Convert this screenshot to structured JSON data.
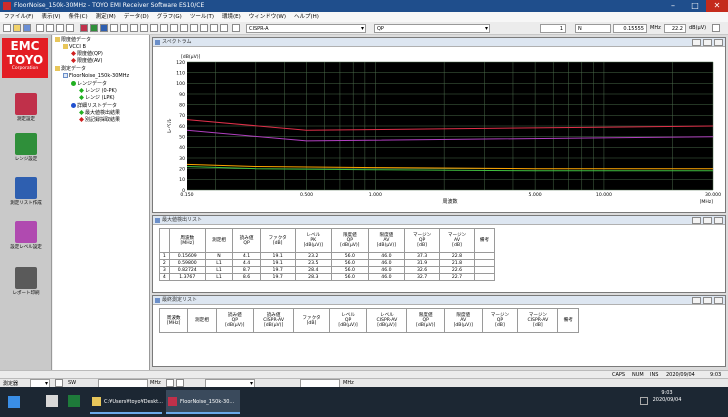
{
  "window": {
    "title": "FloorNoise_150k-30MHz - TOYO EMI Receiver Software ES10/CE"
  },
  "menu": [
    "ファイル(F)",
    "表示(V)",
    "条件(C)",
    "測定(M)",
    "データ(D)",
    "グラフ(G)",
    "ツール(T)",
    "環境(E)",
    "ウィンドウ(W)",
    "ヘルプ(H)"
  ],
  "toolbar": {
    "detector": "CISPR-A",
    "mode": "QP",
    "field1": "1",
    "field2": "N",
    "freq": "0.15555",
    "freq_unit": "MHz",
    "level": "22.2",
    "level_unit": "dB(μV)"
  },
  "sidebar": {
    "logo_main": "EMC",
    "logo_sub": "TOYO",
    "logo_corp": "Corporation",
    "buttons": [
      {
        "label": "測定設定",
        "color": "#c0304a"
      },
      {
        "label": "レンジ設定",
        "color": "#2f8f3a"
      },
      {
        "label": "測定リスト作成",
        "color": "#2e5fb0"
      },
      {
        "label": "設定レベル設定",
        "color": "#b04ab0"
      },
      {
        "label": "レポート印刷",
        "color": "#5a5a5a"
      }
    ]
  },
  "tree": [
    {
      "label": "限度値データ",
      "indent": 0,
      "icon": "folder"
    },
    {
      "label": "VCCI B",
      "indent": 1,
      "icon": "folder"
    },
    {
      "label": "限度値(QP)",
      "indent": 2,
      "icon": "diamond-red"
    },
    {
      "label": "限度値(AV)",
      "indent": 2,
      "icon": "diamond-red"
    },
    {
      "label": "測定データ",
      "indent": 0,
      "icon": "folder"
    },
    {
      "label": "FloorNoise_150k-30MHz",
      "indent": 1,
      "icon": "doc"
    },
    {
      "label": "レンジデータ",
      "indent": 2,
      "icon": "circle-green"
    },
    {
      "label": "レンジ (0-PK)",
      "indent": 3,
      "icon": "diamond-green"
    },
    {
      "label": "レンジ (LPK)",
      "indent": 3,
      "icon": "diamond-green"
    },
    {
      "label": "詳細リストデータ",
      "indent": 2,
      "icon": "circle-blue"
    },
    {
      "label": "最大値検出結果",
      "indent": 3,
      "icon": "diamond-green"
    },
    {
      "label": "別記録採取結果",
      "indent": 3,
      "icon": "diamond-red"
    }
  ],
  "spectrum": {
    "title": "スペクトラム"
  },
  "chart_data": {
    "type": "line",
    "ylabel": "レベル",
    "yunit": "[dB(μV)]",
    "xlabel": "周波数",
    "xunit": "[MHz]",
    "xscale": "log",
    "xlim": [
      0.15,
      30
    ],
    "ylim": [
      0,
      120
    ],
    "xticks": [
      "0.150",
      "0.500",
      "1.000",
      "5.000",
      "10.000",
      "30.000"
    ],
    "yticks": [
      "0",
      "10",
      "20",
      "30",
      "40",
      "50",
      "60",
      "70",
      "80",
      "90",
      "100",
      "110",
      "120"
    ],
    "grid": true,
    "series": [
      {
        "color": "#e0304a",
        "x": [
          0.15,
          0.5,
          0.5,
          30
        ],
        "y": [
          66,
          56,
          56,
          60
        ]
      },
      {
        "color": "#b040c0",
        "x": [
          0.15,
          0.5,
          0.5,
          30
        ],
        "y": [
          56,
          46,
          46,
          50
        ]
      },
      {
        "color": "#ffa500",
        "x": [
          0.15,
          0.3,
          1,
          5,
          10,
          30
        ],
        "y": [
          24,
          22,
          21,
          20,
          20,
          20
        ]
      },
      {
        "color": "#40c040",
        "x": [
          0.15,
          0.3,
          1,
          5,
          10,
          30
        ],
        "y": [
          22,
          20,
          19,
          18,
          18,
          18
        ]
      }
    ]
  },
  "peak_window": {
    "title": "最大値検出リスト",
    "headers": [
      "",
      "周波数\n[MHz]",
      "測定相",
      "読み値\nQP",
      "ファクタ\n[dB]",
      "レベル\nPK\n[dB(μV)]",
      "限度値\nQP\n[dB(μV)]",
      "限度値\nAV\n[dB(μV)]",
      "マージン\nQP\n[dB]",
      "マージン\nAV\n[dB]",
      "備考"
    ],
    "rows": [
      [
        "1",
        "0.15609",
        "N",
        "4.1",
        "19.1",
        "23.2",
        "56.0",
        "46.0",
        "37.3",
        "22.8",
        ""
      ],
      [
        "2",
        "0.59800",
        "L1",
        "4.4",
        "19.1",
        "23.5",
        "56.0",
        "46.0",
        "31.9",
        "21.8",
        ""
      ],
      [
        "3",
        "0.82724",
        "L1",
        "8.7",
        "19.7",
        "28.4",
        "56.0",
        "46.0",
        "32.6",
        "22.6",
        ""
      ],
      [
        "4",
        "1.3767",
        "L1",
        "8.6",
        "19.7",
        "28.3",
        "56.0",
        "46.0",
        "32.7",
        "22.7",
        ""
      ]
    ]
  },
  "final_window": {
    "title": "最終測定リスト",
    "headers": [
      "周波数\n[MHz]",
      "測定相",
      "読み値\nQP\n[dB(μV)]",
      "読み値\nCISPR-AV\n[dB(μV)]",
      "ファクタ\n[dB]",
      "レベル\nQP\n[dB(μV)]",
      "レベル\nCISPR-AV\n[dB(μV)]",
      "限度値\nQP\n[dB(μV)]",
      "限度値\nAV\n[dB(μV)]",
      "マージン\nQP\n[dB]",
      "マージン\nCISPR-AV\n[dB]",
      "備考"
    ]
  },
  "status": {
    "caps": "CAPS",
    "num": "NUM",
    "ins": "INS",
    "date": "2020/09/04",
    "time": "9:03"
  },
  "bottom": {
    "label1": "測定器",
    "freq_unit": "MHz",
    "sw": "SW",
    "freq_unit2": "MHz"
  },
  "taskbar": {
    "items": [
      "C:¥Users¥toyo¥Deskt...",
      "FloorNoise_150k-30..."
    ],
    "clock_time": "9:03",
    "clock_date": "2020/09/04"
  }
}
